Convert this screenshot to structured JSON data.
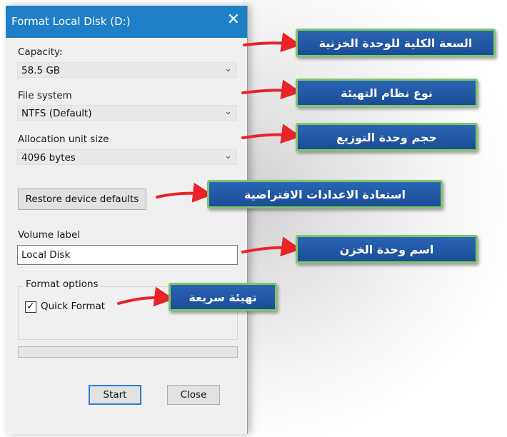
{
  "window": {
    "title": "Format Local Disk (D:)",
    "close_glyph": "✕"
  },
  "capacity": {
    "label": "Capacity:",
    "value": "58.5 GB"
  },
  "file_system": {
    "label": "File system",
    "value": "NTFS (Default)"
  },
  "allocation": {
    "label": "Allocation unit size",
    "value": "4096 bytes"
  },
  "restore_button": "Restore device defaults",
  "volume": {
    "label": "Volume label",
    "value": "Local Disk"
  },
  "format_options": {
    "title": "Format options",
    "quick_format": {
      "label": "Quick Format",
      "checked": true
    }
  },
  "progress": {
    "percent": 0
  },
  "buttons": {
    "start": "Start",
    "close": "Close"
  },
  "icons": {
    "dropdown": "chevron-down-icon",
    "check": "check-icon",
    "close": "close-icon"
  },
  "annotations": {
    "capacity": "السعة الكلية للوحدة الخزنية",
    "file_system": "نوع نظام التهيئة",
    "allocation": "حجم وحدة التوزيع",
    "restore": "استعادة الاعدادات الافتراضية",
    "volume": "اسم وحدة الخزن",
    "quick_format": "تهيئة سريعة"
  },
  "colors": {
    "titlebar": "#1f80c8",
    "callout_fill": "#1f57a6",
    "callout_border": "#7fc56a",
    "arrow": "#e8232a",
    "primary_button_border": "#2a7dd1"
  }
}
